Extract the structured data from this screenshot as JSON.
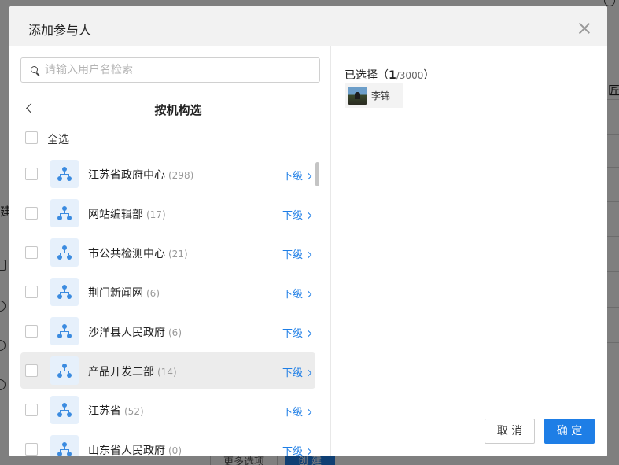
{
  "background": {
    "side_text": "建",
    "col_text": "匠",
    "more_options_label": "更多选项",
    "create_label": "创 建"
  },
  "modal": {
    "title": "添加参与人",
    "search": {
      "placeholder": "请输入用户名检索",
      "value": ""
    },
    "pane_title": "按机构选",
    "select_all_label": "全选",
    "sub_link_label": "下级",
    "orgs": [
      {
        "name": "江苏省政府中心",
        "count": "(298)",
        "highlighted": false
      },
      {
        "name": "网站编辑部",
        "count": "(17)",
        "highlighted": false
      },
      {
        "name": "市公共检测中心",
        "count": "(21)",
        "highlighted": false
      },
      {
        "name": "荆门新闻网",
        "count": "(6)",
        "highlighted": false
      },
      {
        "name": "沙洋县人民政府",
        "count": "(6)",
        "highlighted": false
      },
      {
        "name": "产品开发二部",
        "count": "(14)",
        "highlighted": true
      },
      {
        "name": "江苏省",
        "count": "(52)",
        "highlighted": false
      },
      {
        "name": "山东省人民政府",
        "count": "(0)",
        "highlighted": false
      }
    ],
    "selected": {
      "label": "已选择",
      "open_paren": "（",
      "count": "1",
      "max": "/3000",
      "close_paren": "）",
      "people": [
        {
          "name": "李锦"
        }
      ]
    },
    "cancel_label": "取 消",
    "confirm_label": "确 定"
  },
  "colors": {
    "accent": "#1e7ee6",
    "highlight_row": "#ececec",
    "org_icon_bg": "#e6f0fb"
  }
}
